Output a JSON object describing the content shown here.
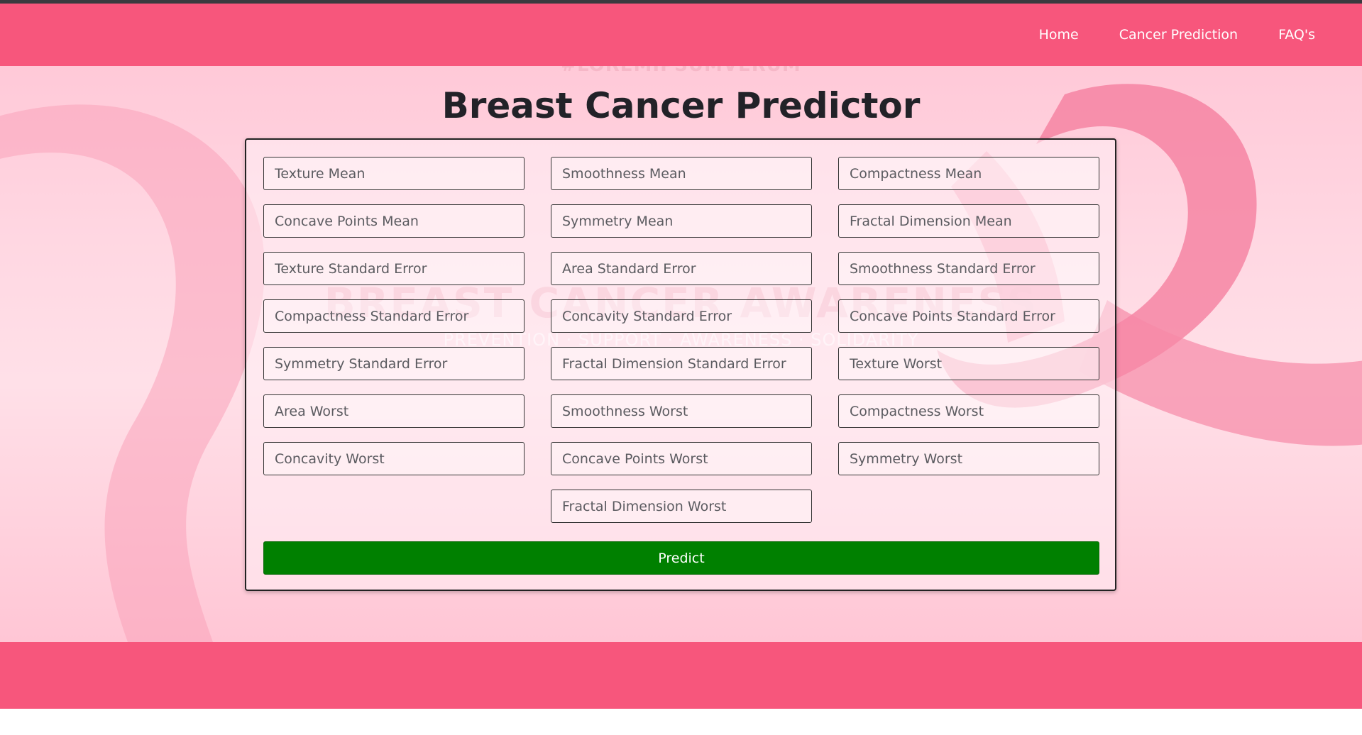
{
  "nav": {
    "links": [
      "Home",
      "Cancer Prediction",
      "FAQ's"
    ]
  },
  "hero": {
    "bg_text_top": "#LOREMIPSUMVERUM",
    "bg_text_awareness": "BREAST CANCER AWARENESS",
    "bg_text_sub": "PREVENTION · SUPPORT · AWARENESS · SOLIDARITY"
  },
  "page": {
    "title": "Breast Cancer Predictor"
  },
  "form": {
    "fields": [
      "Texture Mean",
      "Smoothness Mean",
      "Compactness Mean",
      "Concave Points Mean",
      "Symmetry Mean",
      "Fractal Dimension Mean",
      "Texture Standard Error",
      "Area Standard Error",
      "Smoothness Standard Error",
      "Compactness Standard Error",
      "Concavity Standard Error",
      "Concave Points Standard Error",
      "Symmetry Standard Error",
      "Fractal Dimension Standard Error",
      "Texture Worst",
      "Area Worst",
      "Smoothness Worst",
      "Compactness Worst",
      "Concavity Worst",
      "Concave Points Worst",
      "Symmetry Worst",
      "Fractal Dimension Worst"
    ],
    "submit_label": "Predict"
  },
  "colors": {
    "navbar": "#f7567c",
    "footer": "#f7567c",
    "predict_button": "#008000"
  }
}
